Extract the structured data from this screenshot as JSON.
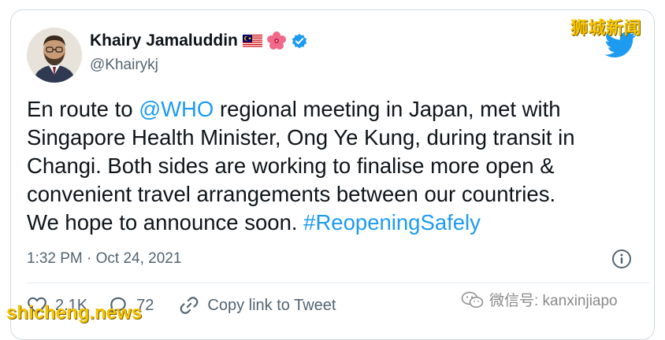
{
  "author": {
    "name": "Khairy Jamaluddin",
    "handle": "@Khairykj"
  },
  "tweet": {
    "text_lines": [
      {
        "before": "En route to ",
        "mention": "@WHO",
        "after": " regional meeting in Japan, met with"
      },
      {
        "text": "Singapore Health Minister, Ong Ye Kung, during transit in"
      },
      {
        "text": "Changi. Both sides are working to finalise more open &"
      },
      {
        "text": "convenient travel arrangements between our countries."
      },
      {
        "before": "We hope to announce soon. ",
        "hashtag": "#ReopeningSafely"
      }
    ],
    "timestamp": "1:32 PM · Oct 24, 2021"
  },
  "actions": {
    "likes": "2.1K",
    "replies": "72",
    "copy_link": "Copy link to Tweet"
  },
  "watermarks": {
    "top": "狮城新闻",
    "bottom": "shicheng.news",
    "wechat": "微信号: kanxinjiapo"
  },
  "colors": {
    "link": "#1d9bf0",
    "verified": "#1d9bf0",
    "watermark": "#f5c400"
  }
}
